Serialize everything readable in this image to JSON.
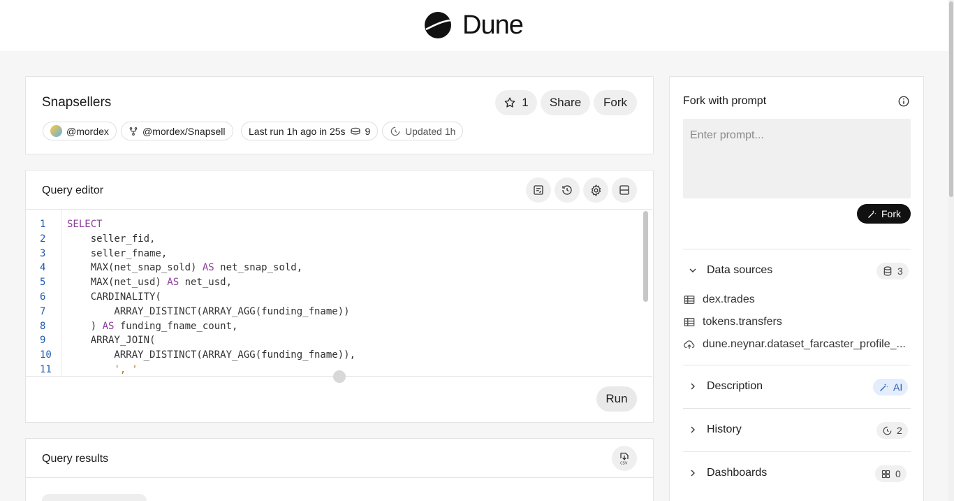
{
  "brand": {
    "name": "Dune"
  },
  "query": {
    "title": "Snapsellers",
    "stars": "1",
    "share_label": "Share",
    "fork_label": "Fork",
    "owner": "@mordex",
    "fork_path": "@mordex/Snapsell",
    "last_run": "Last run 1h ago in 25s",
    "credits": "9",
    "updated": "Updated 1h"
  },
  "editor": {
    "title": "Query editor",
    "run_label": "Run",
    "lines": [
      {
        "n": "1",
        "code": "SELECT"
      },
      {
        "n": "2",
        "code": "    seller_fid,"
      },
      {
        "n": "3",
        "code": "    seller_fname,"
      },
      {
        "n": "4",
        "code": "    MAX(net_snap_sold) AS net_snap_sold,"
      },
      {
        "n": "5",
        "code": "    MAX(net_usd) AS net_usd,"
      },
      {
        "n": "6",
        "code": "    CARDINALITY("
      },
      {
        "n": "7",
        "code": "        ARRAY_DISTINCT(ARRAY_AGG(funding_fname))"
      },
      {
        "n": "8",
        "code": "    ) AS funding_fname_count,"
      },
      {
        "n": "9",
        "code": "    ARRAY_JOIN("
      },
      {
        "n": "10",
        "code": "        ARRAY_DISTINCT(ARRAY_AGG(funding_fname)),"
      },
      {
        "n": "11",
        "code": "        ', '"
      }
    ]
  },
  "results": {
    "title": "Query results"
  },
  "sidebar": {
    "fork_title": "Fork with prompt",
    "prompt_placeholder": "Enter prompt...",
    "fork_button": "Fork",
    "data_sources_label": "Data sources",
    "data_sources_count": "3",
    "sources": [
      "dex.trades",
      "tokens.transfers",
      "dune.neynar.dataset_farcaster_profile_..."
    ],
    "description_label": "Description",
    "ai_label": "AI",
    "history_label": "History",
    "history_count": "2",
    "dashboards_label": "Dashboards",
    "dashboards_count": "0"
  },
  "colors": {
    "accent_dark": "#111111",
    "keyword": "#8c3f9a",
    "line_number": "#1d5bb3",
    "ai_badge_bg": "#e3edfb",
    "ai_badge_text": "#2d5fb5"
  }
}
